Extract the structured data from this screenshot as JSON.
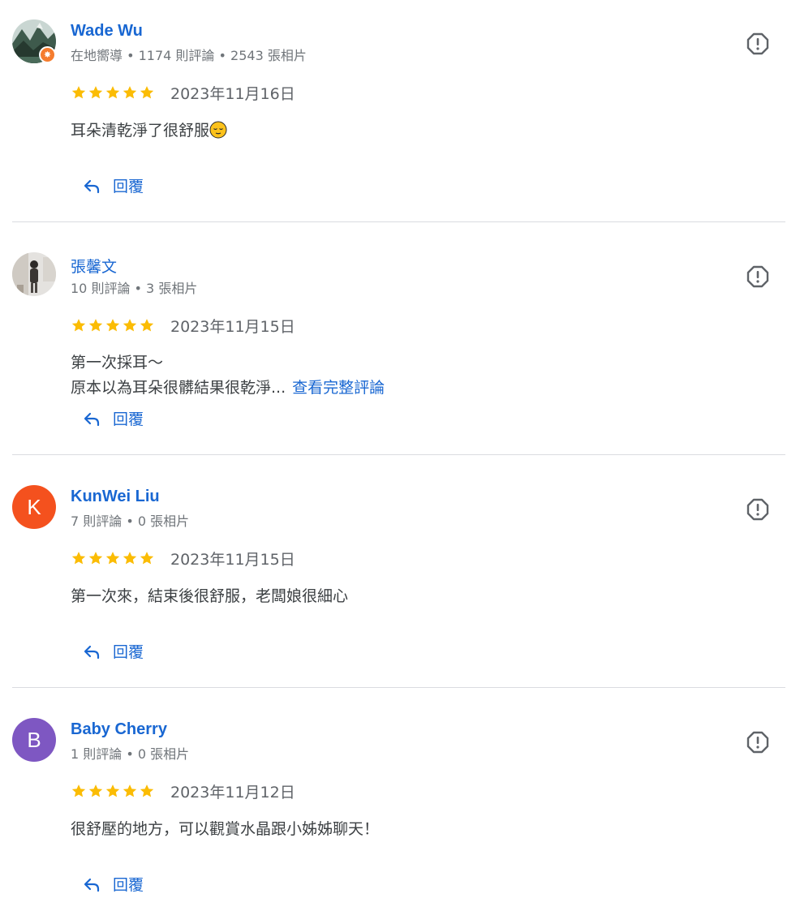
{
  "colors": {
    "link_blue": "#1967d2",
    "star_gold": "#fbbc04",
    "meta_gray": "#70757a",
    "divider": "#dadce0",
    "avatar_k": "#f4511e",
    "avatar_b": "#7e57c2",
    "badge_orange": "#f57c2e"
  },
  "reviews": [
    {
      "author": "Wade Wu",
      "meta": "在地嚮導 • 1174 則評論 • 2543 張相片",
      "avatar": "photo",
      "local_guide": true,
      "rating": 5,
      "date": "2023年11月16日",
      "text_lines": [
        "耳朵清乾淨了很舒服"
      ],
      "emoji": "relieved-face",
      "see_more": "",
      "reply_label": "回覆",
      "more_icon": "report-icon"
    },
    {
      "author": "張馨文",
      "meta": "10 則評論 • 3 張相片",
      "avatar": "photo",
      "local_guide": false,
      "rating": 5,
      "date": "2023年11月15日",
      "text_lines": [
        "第一次採耳～",
        "原本以為耳朵很髒結果很乾淨..."
      ],
      "see_more": "查看完整評論",
      "reply_label": "回覆",
      "more_icon": "report-icon"
    },
    {
      "author": "KunWei Liu",
      "meta": "7 則評論 • 0 張相片",
      "avatar": "letter",
      "avatar_letter": "K",
      "local_guide": false,
      "rating": 5,
      "date": "2023年11月15日",
      "text_lines": [
        "第一次來，結束後很舒服，老闆娘很細心"
      ],
      "see_more": "",
      "reply_label": "回覆",
      "more_icon": "report-icon"
    },
    {
      "author": "Baby Cherry",
      "meta": "1 則評論 • 0 張相片",
      "avatar": "letter",
      "avatar_letter": "B",
      "local_guide": false,
      "rating": 5,
      "date": "2023年11月12日",
      "text_lines": [
        "很舒壓的地方，可以觀賞水晶跟小姊姊聊天！"
      ],
      "see_more": "",
      "reply_label": "回覆",
      "more_icon": "report-icon"
    }
  ]
}
